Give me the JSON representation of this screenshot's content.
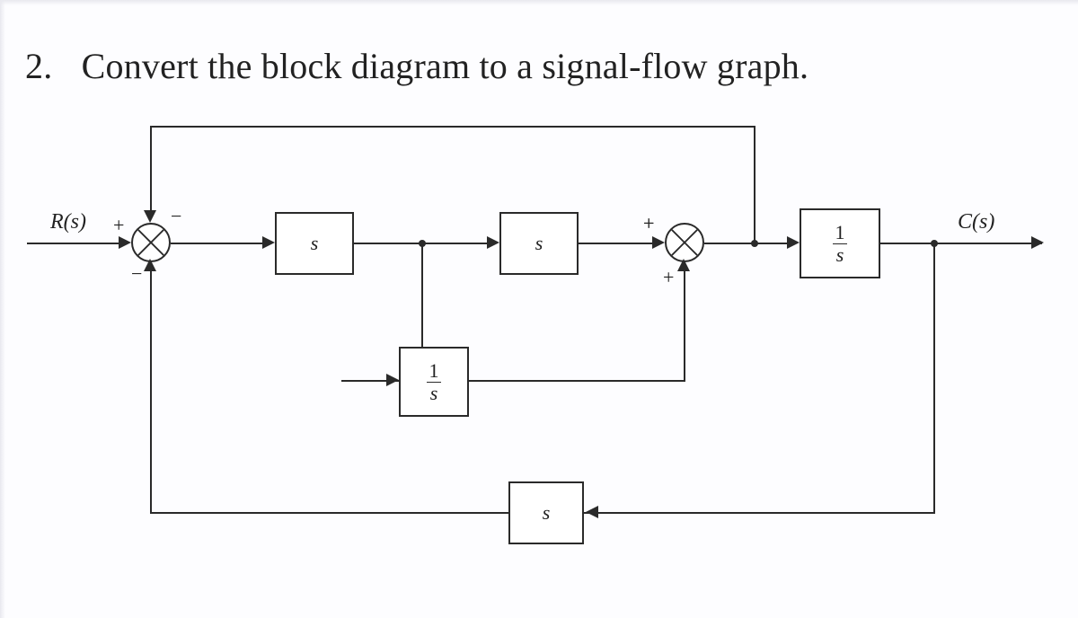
{
  "question_number": "2.",
  "question_text": "Convert the block diagram to a signal-flow graph.",
  "input_label": "R(s)",
  "output_label": "C(s)",
  "summers": {
    "sum1": {
      "left": "+",
      "top": "−",
      "bottom": "−"
    },
    "sum2": {
      "left": "+",
      "top": "+",
      "bottom": "+"
    }
  },
  "blocks": {
    "g1": "s",
    "g2": "s",
    "g3_num": "1",
    "g3_den": "s",
    "inner_fb_num": "1",
    "inner_fb_den": "s",
    "outer_fb": "s"
  }
}
